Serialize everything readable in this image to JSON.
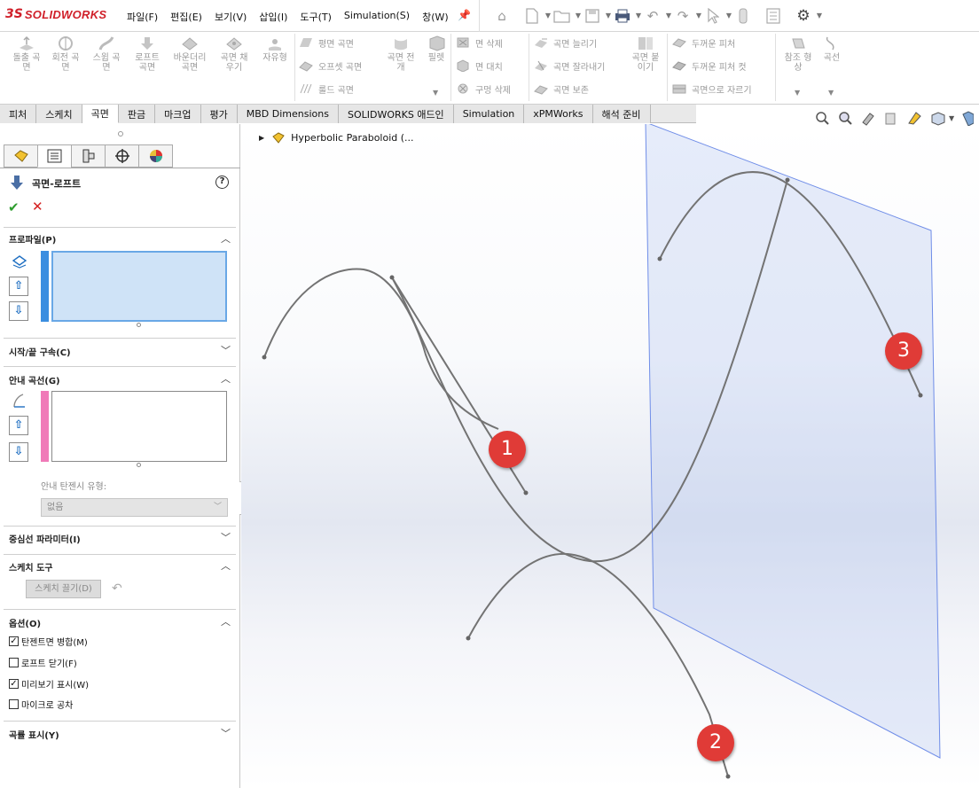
{
  "app": {
    "logo_ds": "3S",
    "logo_name": "SOLIDWORKS"
  },
  "menus": [
    "파일(F)",
    "편집(E)",
    "보기(V)",
    "삽입(I)",
    "도구(T)",
    "Simulation(S)",
    "창(W)"
  ],
  "command_manager": {
    "big_buttons": [
      {
        "label": "돌출 곡\n면",
        "icon": "extrude-surface-icon"
      },
      {
        "label": "회전 곡\n면",
        "icon": "revolve-surface-icon"
      },
      {
        "label": "스윕 곡\n면",
        "icon": "sweep-surface-icon"
      },
      {
        "label": "로프트\n곡면",
        "icon": "loft-surface-icon"
      },
      {
        "label": "바운더리\n곡면",
        "icon": "boundary-surface-icon"
      },
      {
        "label": "곡면 채\n우기",
        "icon": "fill-surface-icon"
      },
      {
        "label": "자유형",
        "icon": "freeform-icon"
      }
    ],
    "col1": [
      "평면 곡면",
      "오프셋 곡면",
      "룰드 곡면"
    ],
    "col1_big": {
      "label": "곡면 전\n개",
      "icon": "flatten-surface-icon"
    },
    "col1_big2": {
      "label": "필렛",
      "icon": "fillet-icon"
    },
    "col2": [
      "면 삭제",
      "면 대치",
      "구멍 삭제"
    ],
    "col3": [
      "곡면 늘리기",
      "곡면 잘라내기",
      "곡면 보존"
    ],
    "col3_big": {
      "label": "곡면 붙\n이기",
      "icon": "knit-surface-icon"
    },
    "col4": [
      "두꺼운 피처",
      "두꺼운 피처 컷",
      "곡면으로 자르기"
    ],
    "col5_big": {
      "label": "참조 형\n상",
      "icon": "reference-geometry-icon"
    },
    "col6_big": {
      "label": "곡선",
      "icon": "curves-icon"
    }
  },
  "tabs": [
    {
      "label": "피처",
      "active": false
    },
    {
      "label": "스케치",
      "active": false
    },
    {
      "label": "곡면",
      "active": true
    },
    {
      "label": "판금",
      "active": false
    },
    {
      "label": "마크업",
      "active": false
    },
    {
      "label": "평가",
      "active": false
    },
    {
      "label": "MBD Dimensions",
      "active": false
    },
    {
      "label": "SOLIDWORKS 애드인",
      "active": false
    },
    {
      "label": "Simulation",
      "active": false
    },
    {
      "label": "xPMWorks",
      "active": false
    },
    {
      "label": "해석 준비",
      "active": false
    }
  ],
  "property_manager": {
    "title": "곡면-로프트",
    "sections": {
      "profile": "프로파일(P)",
      "start_end": "시작/끝 구속(C)",
      "guide": "안내 곡선(G)",
      "guide_tangency_label": "안내 탄젠시 유형:",
      "guide_tangency_value": "없음",
      "centerline": "중심선 파라미터(I)",
      "sketch_tools": "스케치 도구",
      "sketch_drag": "스케치 끌기(D)",
      "options": "옵션(O)",
      "curvature": "곡률 표시(Y)"
    },
    "options": [
      {
        "label": "탄젠트면 병합(M)",
        "checked": true
      },
      {
        "label": "로프트 닫기(F)",
        "checked": false
      },
      {
        "label": "미리보기 표시(W)",
        "checked": true
      },
      {
        "label": "마이크로 공차",
        "checked": false
      }
    ],
    "colors": {
      "profile_bar": "#3b8ee0",
      "guide_bar": "#f07ab8",
      "profile_box": "#cfe3f7"
    }
  },
  "tree": {
    "part_name": "Hyperbolic Paraboloid (..."
  },
  "badges": [
    "1",
    "2",
    "3"
  ],
  "colors": {
    "badge": "#e03b37",
    "curve": "#737373",
    "plane": "#6f8de8"
  }
}
